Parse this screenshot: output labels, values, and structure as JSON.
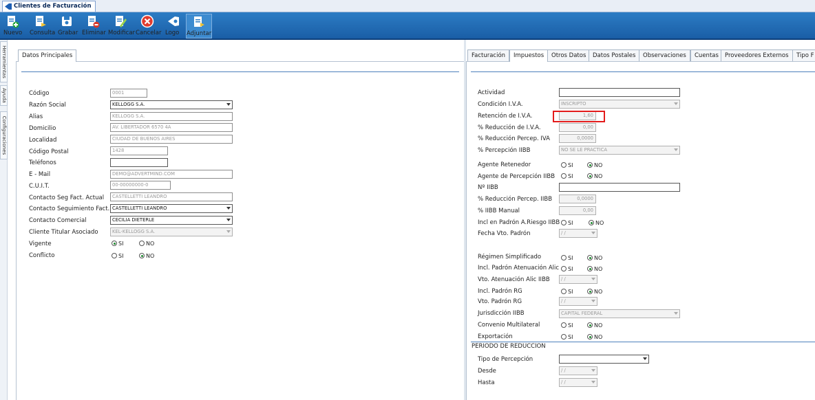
{
  "window": {
    "tab_title": "Clientes de Facturación"
  },
  "toolbar": {
    "nuevo": "Nuevo",
    "consulta": "Consulta",
    "grabar": "Grabar",
    "eliminar": "Eliminar",
    "modificar": "Modificar",
    "cancelar": "Cancelar",
    "logo": "Logo",
    "adjuntar": "Adjuntar"
  },
  "side_tabs": {
    "herramientas": "Herramientas",
    "ayuda": "Ayuda",
    "configuraciones": "Configuraciones"
  },
  "left": {
    "tab": "Datos Principales",
    "labels": {
      "codigo": "Código",
      "razon_social": "Razón Social",
      "alias": "Alias",
      "domicilio": "Domicilio",
      "localidad": "Localidad",
      "codigo_postal": "Código Postal",
      "telefonos": "Teléfonos",
      "email": "E - Mail",
      "cuit": "C.U.I.T.",
      "contacto_seg_actual": "Contacto Seg Fact. Actual",
      "contacto_seguimiento": "Contacto Seguimiento Fact.",
      "contacto_comercial": "Contacto Comercial",
      "cliente_titular": "Cliente Titular Asociado",
      "vigente": "Vigente",
      "conflicto": "Conflicto"
    },
    "values": {
      "codigo": "0001",
      "razon_social": "KELLOGG S.A.",
      "alias": "KELLOGG S.A.",
      "domicilio": "AV. LIBERTADOR 6570 4A",
      "localidad": "CIUDAD DE BUENOS AIRES",
      "codigo_postal": "1428",
      "telefonos": "",
      "email": "DEMO@ADVERTMIND.COM",
      "cuit": "00-00000000-0",
      "contacto_seg_actual": "CASTELLETTI LEANDRO",
      "contacto_seguimiento": "CASTELLETTI LEANDRO",
      "contacto_comercial": "CECILIA DIETERLE",
      "cliente_titular": "KEL-KELLOGG S.A."
    },
    "radio": {
      "si": "SI",
      "no": "NO"
    }
  },
  "right": {
    "tabs": [
      "Facturación",
      "Impuestos",
      "Otros Datos",
      "Datos Postales",
      "Observaciones",
      "Cuentas",
      "Proveedores Externos",
      "Tipo F"
    ],
    "labels": {
      "actividad": "Actividad",
      "condicion_iva": "Condición I.V.A.",
      "retencion_iva": "Retención de I.V.A.",
      "reduccion_iva": "% Reducción de I.V.A.",
      "reduccion_percep_iva": "% Reducción Percep. IVA",
      "percepcion_iibb": "% Percepción IIBB",
      "agente_retenedor": "Agente Retenedor",
      "agente_percepcion": "Agente de Percepción IIBB",
      "nro_iibb": "Nº IIBB",
      "reduccion_percep_iibb": "% Reducción Percep. IIBB",
      "iibb_manual": "% IIBB Manual",
      "incl_padron_riesgo": "Incl en Padrón A.Riesgo IIBB",
      "fecha_vto_padron": "Fecha Vto. Padrón",
      "regimen_simplificado": "Régimen Simplificado",
      "incl_padron_atenuacion": "Incl. Padrón Atenuación Alic",
      "vto_atenuacion": "Vto. Atenuación Alic IIBB",
      "incl_padron_rg": "Incl. Padrón RG",
      "vto_padron_rg": "Vto. Padrón RG",
      "jurisdiccion": "Jurisdicción IIBB",
      "convenio": "Convenio Multilateral",
      "exportacion": "Exportación",
      "periodo_reduccion": "PERIODO DE REDUCCION",
      "tipo_percepcion": "Tipo de Percepción",
      "desde": "Desde",
      "hasta": "Hasta"
    },
    "values": {
      "actividad": "",
      "condicion_iva": "INSCRIPTO",
      "retencion_iva": "1,60",
      "reduccion_iva": "0,00",
      "reduccion_percep_iva": "0,0000",
      "percepcion_iibb": "NO SE LE PRACTICA",
      "nro_iibb": "",
      "reduccion_percep_iibb": "0,0000",
      "iibb_manual": "0,00",
      "fecha_vto_padron": "/ /",
      "vto_atenuacion": "/ /",
      "vto_padron_rg": "/ /",
      "jurisdiccion": "CAPITAL FEDERAL",
      "tipo_percepcion": "",
      "desde": "/ /",
      "hasta": "/ /"
    },
    "radio": {
      "si": "SI",
      "no": "NO"
    }
  },
  "colors": {
    "toolbar": "#1a5ea6",
    "highlight": "#e31b1b",
    "divider": "#4c80bc"
  }
}
